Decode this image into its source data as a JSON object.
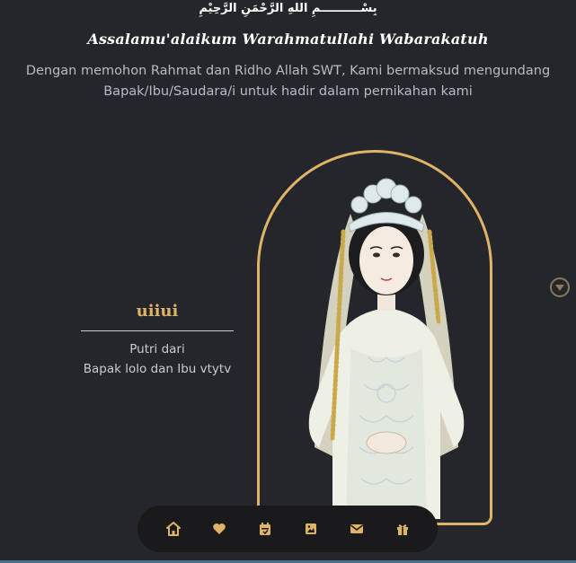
{
  "header": {
    "bismillah": "بِسْــــــــــمِ اللهِ الرَّحْمَنِ الرَّحِيْمِ",
    "salam": "Assalamu'alaikum Warahmatullahi Wabarakatuh",
    "intro_line1": "Dengan memohon Rahmat dan Ridho Allah SWT, Kami bermaksud mengundang",
    "intro_line2": "Bapak/Ibu/Saudara/i untuk hadir dalam pernikahan kami"
  },
  "bride": {
    "name": "uiiui",
    "child_of_label": "Putri dari",
    "parents": "Bapak lolo dan Ibu vtytv"
  },
  "nav": {
    "items": [
      {
        "icon": "home-icon"
      },
      {
        "icon": "heart-icon"
      },
      {
        "icon": "calendar-icon"
      },
      {
        "icon": "gallery-icon"
      },
      {
        "icon": "mail-icon"
      },
      {
        "icon": "gift-icon"
      }
    ]
  },
  "colors": {
    "background": "#24262b",
    "accent_gold": "#e0b466",
    "navbar_bg": "#1a1a1c"
  }
}
